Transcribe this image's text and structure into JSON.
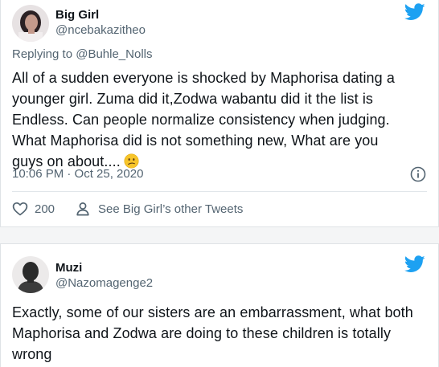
{
  "tweets": [
    {
      "display_name": "Big Girl",
      "handle": "@ncebakazitheo",
      "replying_prefix": "Replying to ",
      "replying_to": "@Buhle_Nolls",
      "text_lines": [
        "All of a sudden everyone is shocked by Maphorisa dating a",
        "younger girl. Zuma did it,Zodwa wabantu did it the list is",
        "Endless. Can people normalize consistency when judging.",
        "What Maphorisa did is not something new, What are you",
        "guys on about...."
      ],
      "emoji": "confused-face-emoji",
      "timestamp": "10:06 PM · Oct 25, 2020",
      "like_count": "200",
      "other_tweets_label": "See Big Girl’s other Tweets"
    },
    {
      "display_name": "Muzi",
      "handle": "@Nazomagenge2",
      "text_lines": [
        "Exactly, some of our sisters are an embarrassment, what both",
        "Maphorisa and Zodwa are doing to these children is totally",
        "wrong"
      ]
    }
  ],
  "colors": {
    "twitter_blue": "#1da1f2",
    "secondary_text": "#536471",
    "primary_text": "#0f1419"
  },
  "icons": [
    "twitter-bird-icon",
    "info-icon",
    "heart-icon",
    "person-icon"
  ]
}
